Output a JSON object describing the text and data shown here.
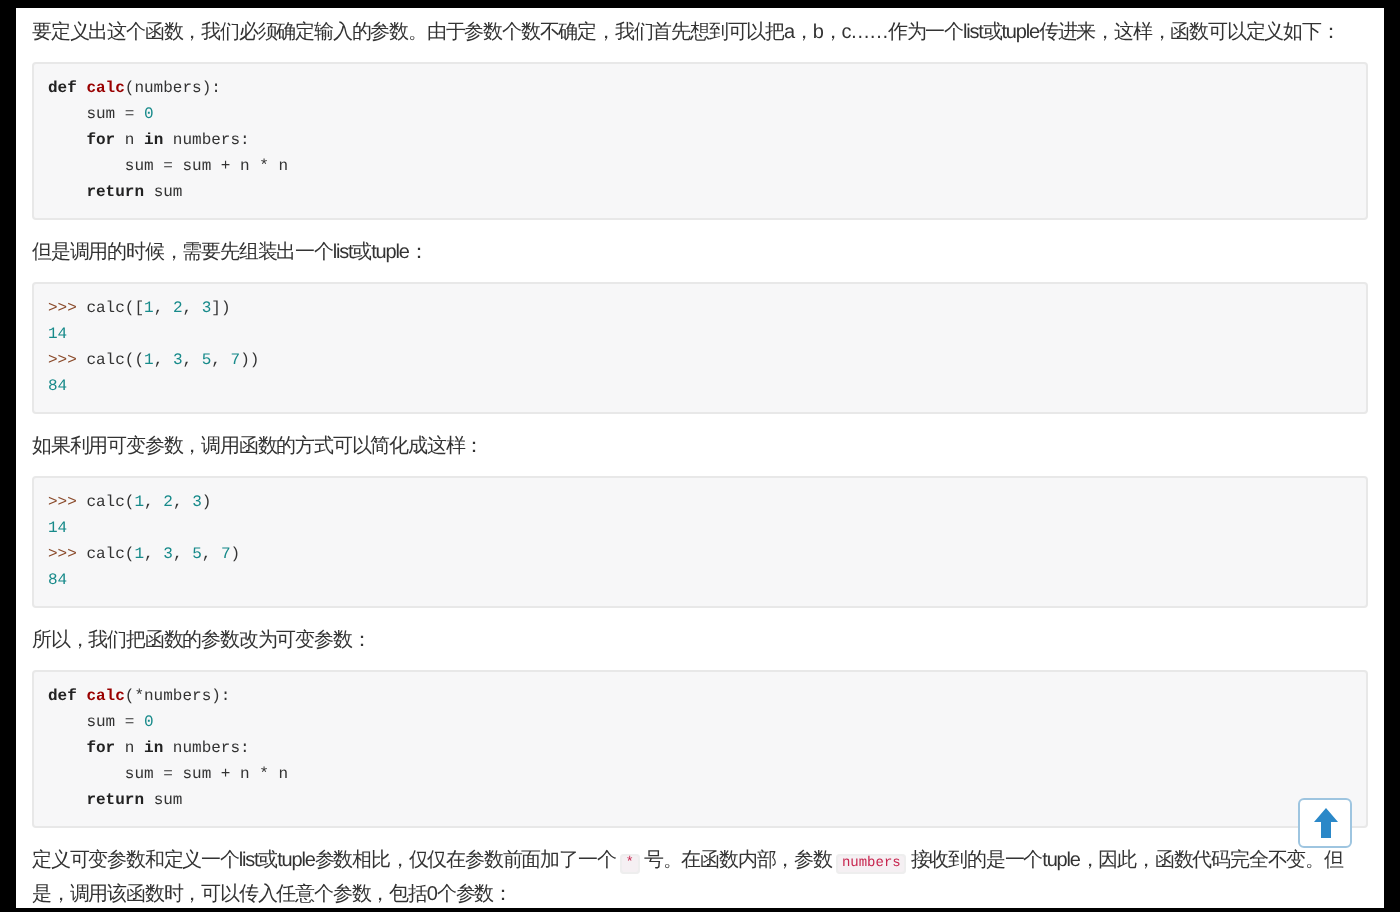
{
  "blocks": [
    {
      "kind": "paragraph",
      "segments": [
        {
          "kind": "text",
          "text": "要定义出这个函数，我们必须确定输入的参数。由于参数个数不确定，我们首先想到可以把a，b，c……作为一个list或tuple传进来，这样，函数可以定义如下："
        }
      ]
    },
    {
      "kind": "code",
      "lines": [
        [
          {
            "kind": "keyword",
            "text": "def "
          },
          {
            "kind": "function",
            "text": "calc"
          },
          {
            "kind": "plain",
            "text": "(numbers):"
          }
        ],
        [
          {
            "kind": "plain",
            "text": "    sum = "
          },
          {
            "kind": "number",
            "text": "0"
          }
        ],
        [
          {
            "kind": "keyword",
            "text": "    for"
          },
          {
            "kind": "plain",
            "text": " n "
          },
          {
            "kind": "keyword",
            "text": "in"
          },
          {
            "kind": "plain",
            "text": " numbers:"
          }
        ],
        [
          {
            "kind": "plain",
            "text": "        sum = sum + n * n"
          }
        ],
        [
          {
            "kind": "keyword",
            "text": "    return"
          },
          {
            "kind": "plain",
            "text": " sum"
          }
        ]
      ]
    },
    {
      "kind": "paragraph",
      "segments": [
        {
          "kind": "text",
          "text": "但是调用的时候，需要先组装出一个list或tuple："
        }
      ]
    },
    {
      "kind": "code",
      "lines": [
        [
          {
            "kind": "prompt",
            "text": ">>>"
          },
          {
            "kind": "plain",
            "text": " calc(["
          },
          {
            "kind": "number",
            "text": "1"
          },
          {
            "kind": "plain",
            "text": ", "
          },
          {
            "kind": "number",
            "text": "2"
          },
          {
            "kind": "plain",
            "text": ", "
          },
          {
            "kind": "number",
            "text": "3"
          },
          {
            "kind": "plain",
            "text": "])"
          }
        ],
        [
          {
            "kind": "number",
            "text": "14"
          }
        ],
        [
          {
            "kind": "prompt",
            "text": ">>>"
          },
          {
            "kind": "plain",
            "text": " calc(("
          },
          {
            "kind": "number",
            "text": "1"
          },
          {
            "kind": "plain",
            "text": ", "
          },
          {
            "kind": "number",
            "text": "3"
          },
          {
            "kind": "plain",
            "text": ", "
          },
          {
            "kind": "number",
            "text": "5"
          },
          {
            "kind": "plain",
            "text": ", "
          },
          {
            "kind": "number",
            "text": "7"
          },
          {
            "kind": "plain",
            "text": "))"
          }
        ],
        [
          {
            "kind": "number",
            "text": "84"
          }
        ]
      ]
    },
    {
      "kind": "paragraph",
      "segments": [
        {
          "kind": "text",
          "text": "如果利用可变参数，调用函数的方式可以简化成这样："
        }
      ]
    },
    {
      "kind": "code",
      "lines": [
        [
          {
            "kind": "prompt",
            "text": ">>>"
          },
          {
            "kind": "plain",
            "text": " calc("
          },
          {
            "kind": "number",
            "text": "1"
          },
          {
            "kind": "plain",
            "text": ", "
          },
          {
            "kind": "number",
            "text": "2"
          },
          {
            "kind": "plain",
            "text": ", "
          },
          {
            "kind": "number",
            "text": "3"
          },
          {
            "kind": "plain",
            "text": ")"
          }
        ],
        [
          {
            "kind": "number",
            "text": "14"
          }
        ],
        [
          {
            "kind": "prompt",
            "text": ">>>"
          },
          {
            "kind": "plain",
            "text": " calc("
          },
          {
            "kind": "number",
            "text": "1"
          },
          {
            "kind": "plain",
            "text": ", "
          },
          {
            "kind": "number",
            "text": "3"
          },
          {
            "kind": "plain",
            "text": ", "
          },
          {
            "kind": "number",
            "text": "5"
          },
          {
            "kind": "plain",
            "text": ", "
          },
          {
            "kind": "number",
            "text": "7"
          },
          {
            "kind": "plain",
            "text": ")"
          }
        ],
        [
          {
            "kind": "number",
            "text": "84"
          }
        ]
      ]
    },
    {
      "kind": "paragraph",
      "segments": [
        {
          "kind": "text",
          "text": "所以，我们把函数的参数改为可变参数："
        }
      ]
    },
    {
      "kind": "code",
      "lines": [
        [
          {
            "kind": "keyword",
            "text": "def "
          },
          {
            "kind": "function",
            "text": "calc"
          },
          {
            "kind": "plain",
            "text": "(*numbers):"
          }
        ],
        [
          {
            "kind": "plain",
            "text": "    sum = "
          },
          {
            "kind": "number",
            "text": "0"
          }
        ],
        [
          {
            "kind": "keyword",
            "text": "    for"
          },
          {
            "kind": "plain",
            "text": " n "
          },
          {
            "kind": "keyword",
            "text": "in"
          },
          {
            "kind": "plain",
            "text": " numbers:"
          }
        ],
        [
          {
            "kind": "plain",
            "text": "        sum = sum + n * n"
          }
        ],
        [
          {
            "kind": "keyword",
            "text": "    return"
          },
          {
            "kind": "plain",
            "text": " sum"
          }
        ]
      ]
    },
    {
      "kind": "paragraph",
      "segments": [
        {
          "kind": "text",
          "text": "定义可变参数和定义一个list或tuple参数相比，仅仅在参数前面加了一个"
        },
        {
          "kind": "code",
          "text": "*"
        },
        {
          "kind": "text",
          "text": "号。在函数内部，参数"
        },
        {
          "kind": "code",
          "text": "numbers"
        },
        {
          "kind": "text",
          "text": "接收到的是一个tuple，因此，函数代码完全不变。但是，调用该函数时，可以传入任意个参数，包括0个参数："
        }
      ]
    }
  ]
}
